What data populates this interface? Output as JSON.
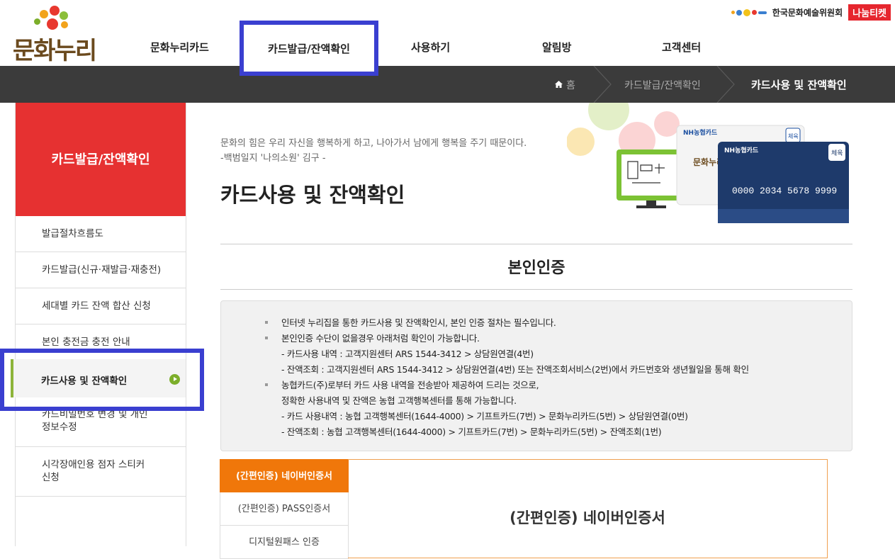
{
  "header": {
    "logo_text": "문화누리",
    "nav": [
      "문화누리카드",
      "카드발급/잔액확인",
      "사용하기",
      "알림방",
      "고객센터"
    ],
    "org_name": "한국문화예술위원회",
    "nanum_ticket": "나눔티켓"
  },
  "breadcrumb": {
    "home": "홈",
    "level1": "카드발급/잔액확인",
    "current": "카드사용 및 잔액확인"
  },
  "sidebar": {
    "title": "카드발급/잔액확인",
    "items": [
      "발급절차흐름도",
      "카드발급(신규·재발급·재충전)",
      "세대별 카드 잔액 합산 신청",
      "본인 충전금 충전 안내",
      "카드사용 및 잔액확인",
      "카드비밀번호 변경 및 개인정보수정",
      "시각장애인용 점자 스티커 신청"
    ]
  },
  "main": {
    "quote_line1": "문화의 힘은 우리 자신을 행복하게 하고, 나아가서 남에게 행복을 주기 때문이다.",
    "quote_line2": "-백범일지 '나의소원' 김구 -",
    "page_title": "카드사용 및 잔액확인",
    "card1_brand": "NH농협카드",
    "card2_brand": "NH농협카드",
    "card_number": "0000 2034 5678 9999",
    "card_logo": "문화누리",
    "card_badge": "체육",
    "section_title": "본인인증",
    "info": [
      "인터넷 누리집을 통한 카드사용 및 잔액확인시, 본인 인증 절차는 필수입니다.",
      "본인인증 수단이 없을경우 아래처럼 확인이 가능합니다.",
      "- 카드사용 내역 : 고객지원센터 ARS 1544-3412 > 상담원연결(4번)",
      "- 잔액조회 : 고객지원센터 ARS 1544-3412 > 상담원연결(4번) 또는 잔액조회서비스(2번)에서 카드번호와 생년월일을 통해 확인",
      "농협카드(주)로부터 카드 사용 내역을 전송받아 제공하여 드리는 것으로,",
      "정확한 사용내역 및 잔액은 농협 고객행복센터를 통해 가능합니다.",
      "- 카드 사용내역 : 농협 고객행복센터(1644-4000) > 기프트카드(7번) > 문화누리카드(5번) > 상담원연결(0번)",
      "- 잔액조회 : 농협 고객행복센터(1644-4000) > 기프트카드(7번) > 문화누리카드(5번) > 잔액조회(1번)"
    ],
    "tabs": [
      "(간편인증) 네이버인증서",
      "(간편인증) PASS인증서",
      "디지털원패스 인증"
    ],
    "panel_title": "(간편인증) 네이버인증서"
  },
  "colors": {
    "accent_red": "#e63131",
    "highlight": "#3a3fd0",
    "tab_orange": "#f0770a",
    "active_green": "#7cae2a"
  }
}
